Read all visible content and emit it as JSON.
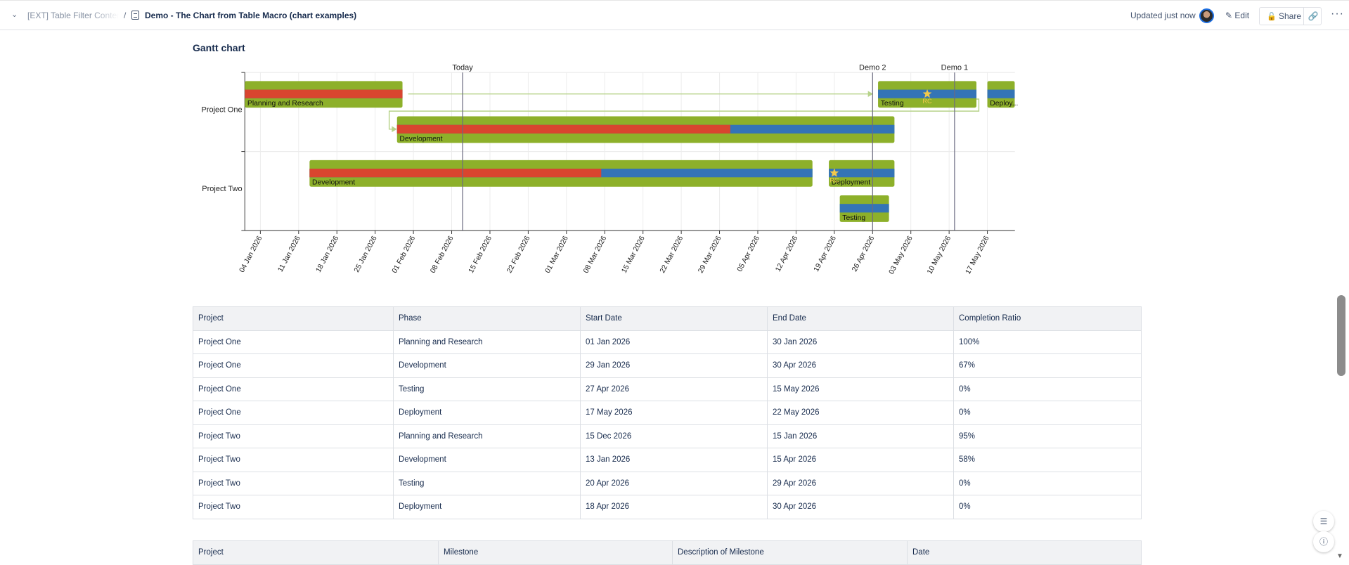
{
  "header": {
    "breadcrumb_parent": "[EXT] Table Filter Content",
    "breadcrumb_page": "Demo - The Chart from Table Macro (chart examples)",
    "updated": "Updated just now",
    "edit": "Edit",
    "share": "Share"
  },
  "section_title": "Gantt chart",
  "chart_data": {
    "type": "gantt",
    "x_range": [
      "2026-01-01",
      "2026-05-22"
    ],
    "categories": [
      "Project One",
      "Project Two"
    ],
    "ticks": [
      "04 Jan 2026",
      "11 Jan 2026",
      "18 Jan 2026",
      "25 Jan 2026",
      "01 Feb 2026",
      "08 Feb 2026",
      "15 Feb 2026",
      "22 Feb 2026",
      "01 Mar 2026",
      "08 Mar 2026",
      "15 Mar 2026",
      "22 Mar 2026",
      "29 Mar 2026",
      "05 Apr 2026",
      "12 Apr 2026",
      "19 Apr 2026",
      "26 Apr 2026",
      "03 May 2026",
      "10 May 2026",
      "17 May 2026"
    ],
    "tasks": [
      {
        "project": "Project One",
        "label": "Planning and Research",
        "start": "2026-01-01",
        "end": "2026-01-30",
        "progress": 1.0
      },
      {
        "project": "Project One",
        "label": "Development",
        "start": "2026-01-29",
        "end": "2026-04-30",
        "progress": 0.67
      },
      {
        "project": "Project One",
        "label": "Testing",
        "start": "2026-04-27",
        "end": "2026-05-15",
        "progress": 0
      },
      {
        "project": "Project One",
        "label": "Deploy...",
        "start": "2026-05-17",
        "end": "2026-05-22",
        "progress": 0
      },
      {
        "project": "Project Two",
        "label": "Development",
        "start": "2026-01-13",
        "end": "2026-04-15",
        "progress": 0.58
      },
      {
        "project": "Project Two",
        "label": "Deployment",
        "start": "2026-04-18",
        "end": "2026-04-30",
        "progress": 0
      },
      {
        "project": "Project Two",
        "label": "Testing",
        "start": "2026-04-20",
        "end": "2026-04-29",
        "progress": 0
      }
    ],
    "markers": [
      {
        "label": "Today",
        "date": "2026-02-10"
      },
      {
        "label": "Demo 2",
        "date": "2026-04-26"
      },
      {
        "label": "Demo 1",
        "date": "2026-05-11"
      }
    ],
    "milestones": [
      {
        "project": "Project One",
        "label": "RC",
        "date": "2026-05-06"
      },
      {
        "project": "Project Two",
        "label": "RC",
        "date": "2026-04-19"
      }
    ],
    "colors": {
      "bar": "#8db02a",
      "done": "#d9452f",
      "remaining": "#3474b6",
      "dependency": "#b7d38a",
      "milestone": "#f2c94c",
      "marker": "#6b6b80"
    }
  },
  "table1": {
    "headers": [
      "Project",
      "Phase",
      "Start Date",
      "End Date",
      "Completion Ratio"
    ],
    "rows": [
      [
        "Project One",
        "Planning and Research",
        "01 Jan 2026",
        "30 Jan 2026",
        "100%"
      ],
      [
        "Project One",
        "Development",
        "29 Jan 2026",
        "30 Apr 2026",
        "67%"
      ],
      [
        "Project One",
        "Testing",
        "27 Apr 2026",
        "15 May 2026",
        "0%"
      ],
      [
        "Project One",
        "Deployment",
        "17 May 2026",
        "22 May 2026",
        "0%"
      ],
      [
        "Project Two",
        "Planning and Research",
        "15 Dec 2026",
        "15 Jan 2026",
        "95%"
      ],
      [
        "Project Two",
        "Development",
        "13 Jan 2026",
        "15 Apr 2026",
        "58%"
      ],
      [
        "Project Two",
        "Testing",
        "20 Apr 2026",
        "29 Apr 2026",
        "0%"
      ],
      [
        "Project Two",
        "Deployment",
        "18 Apr 2026",
        "30 Apr 2026",
        "0%"
      ]
    ]
  },
  "table2": {
    "headers": [
      "Project",
      "Milestone",
      "Description of Milestone",
      "Date"
    ]
  }
}
